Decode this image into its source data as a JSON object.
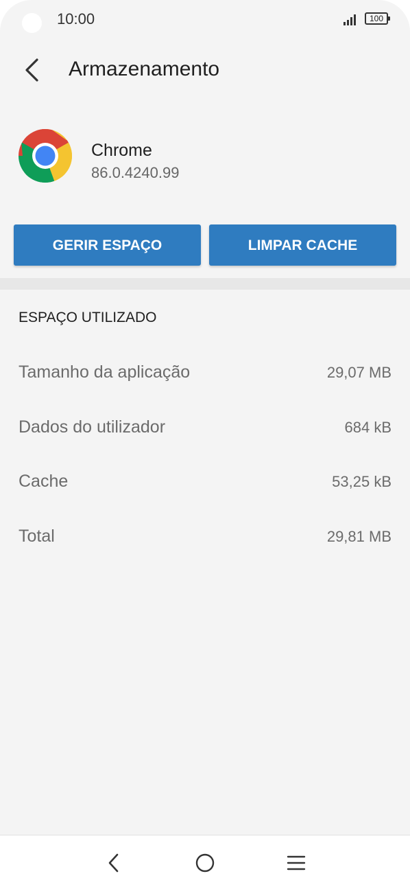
{
  "status_bar": {
    "time": "10:00",
    "battery": "100",
    "icons": [
      "signal-icon",
      "battery-icon"
    ]
  },
  "header": {
    "title": "Armazenamento",
    "back_icon": "chevron-left-icon"
  },
  "app": {
    "name": "Chrome",
    "version": "86.0.4240.99",
    "icon": "chrome-logo-icon"
  },
  "actions": {
    "manage_space": "GERIR ESPAÇO",
    "clear_cache": "LIMPAR CACHE"
  },
  "storage": {
    "section_title": "ESPAÇO UTILIZADO",
    "rows": [
      {
        "label": "Tamanho da aplicação",
        "value": "29,07 MB"
      },
      {
        "label": "Dados do utilizador",
        "value": "684 kB"
      },
      {
        "label": "Cache",
        "value": "53,25 kB"
      },
      {
        "label": "Total",
        "value": "29,81 MB"
      }
    ]
  },
  "nav_bar": {
    "icons": [
      "nav-back-icon",
      "nav-home-icon",
      "nav-menu-icon"
    ]
  },
  "colors": {
    "accent": "#2f7cc0",
    "background": "#f4f4f4",
    "divider": "#e7e7e7"
  }
}
